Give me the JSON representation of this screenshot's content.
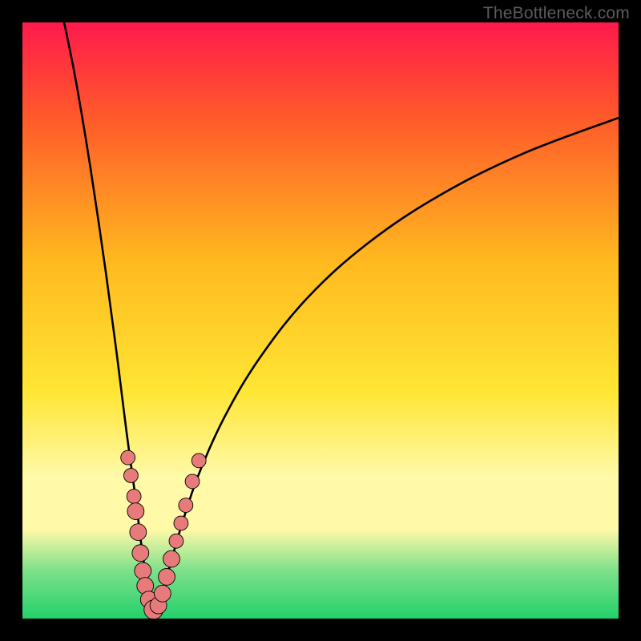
{
  "watermark": "TheBottleneck.com",
  "colors": {
    "grad_top": "#ff1a4c",
    "grad_upper": "#ff5a2a",
    "grad_mid": "#ffb91f",
    "grad_lowmid": "#ffe634",
    "grad_band": "#fff9a8",
    "grad_green1": "#7de08a",
    "grad_green2": "#24d06b",
    "curve": "#000000",
    "dot_fill": "#e77b7c",
    "dot_stroke": "#000000"
  },
  "chart_data": {
    "type": "line",
    "title": "",
    "xlabel": "",
    "ylabel": "",
    "xlim": [
      0,
      100
    ],
    "ylim": [
      0,
      100
    ],
    "x_minimum": 22,
    "gradient_stops": [
      {
        "pct": 0,
        "key": "grad_top"
      },
      {
        "pct": 16,
        "key": "grad_upper"
      },
      {
        "pct": 40,
        "key": "grad_mid"
      },
      {
        "pct": 62,
        "key": "grad_lowmid"
      },
      {
        "pct": 76,
        "key": "grad_band"
      },
      {
        "pct": 85,
        "key": "grad_band"
      },
      {
        "pct": 92,
        "key": "grad_green1"
      },
      {
        "pct": 100,
        "key": "grad_green2"
      }
    ],
    "curve_left": [
      {
        "x": 7.0,
        "y": 100.0
      },
      {
        "x": 9.0,
        "y": 90.0
      },
      {
        "x": 11.5,
        "y": 75.0
      },
      {
        "x": 14.0,
        "y": 58.0
      },
      {
        "x": 16.0,
        "y": 43.0
      },
      {
        "x": 17.5,
        "y": 31.0
      },
      {
        "x": 19.0,
        "y": 20.0
      },
      {
        "x": 20.0,
        "y": 12.0
      },
      {
        "x": 21.0,
        "y": 5.5
      },
      {
        "x": 22.0,
        "y": 1.0
      }
    ],
    "curve_right": [
      {
        "x": 22.0,
        "y": 1.0
      },
      {
        "x": 23.0,
        "y": 3.0
      },
      {
        "x": 24.5,
        "y": 8.0
      },
      {
        "x": 26.5,
        "y": 15.0
      },
      {
        "x": 29.5,
        "y": 24.0
      },
      {
        "x": 34.0,
        "y": 34.0
      },
      {
        "x": 40.0,
        "y": 44.0
      },
      {
        "x": 48.0,
        "y": 54.0
      },
      {
        "x": 58.0,
        "y": 63.0
      },
      {
        "x": 70.0,
        "y": 71.0
      },
      {
        "x": 84.0,
        "y": 78.0
      },
      {
        "x": 100.0,
        "y": 84.0
      }
    ],
    "dots": [
      {
        "x": 17.7,
        "y": 27.0,
        "r": 1.2
      },
      {
        "x": 18.2,
        "y": 24.0,
        "r": 1.2
      },
      {
        "x": 18.7,
        "y": 20.5,
        "r": 1.2
      },
      {
        "x": 19.0,
        "y": 18.0,
        "r": 1.4
      },
      {
        "x": 19.4,
        "y": 14.5,
        "r": 1.4
      },
      {
        "x": 19.8,
        "y": 11.0,
        "r": 1.4
      },
      {
        "x": 20.2,
        "y": 8.0,
        "r": 1.4
      },
      {
        "x": 20.6,
        "y": 5.5,
        "r": 1.4
      },
      {
        "x": 21.2,
        "y": 3.2,
        "r": 1.4
      },
      {
        "x": 22.0,
        "y": 1.5,
        "r": 1.6
      },
      {
        "x": 22.8,
        "y": 2.2,
        "r": 1.4
      },
      {
        "x": 23.5,
        "y": 4.2,
        "r": 1.4
      },
      {
        "x": 24.2,
        "y": 7.0,
        "r": 1.4
      },
      {
        "x": 25.0,
        "y": 10.0,
        "r": 1.4
      },
      {
        "x": 25.8,
        "y": 13.0,
        "r": 1.2
      },
      {
        "x": 26.6,
        "y": 16.0,
        "r": 1.2
      },
      {
        "x": 27.4,
        "y": 19.0,
        "r": 1.2
      },
      {
        "x": 28.5,
        "y": 23.0,
        "r": 1.2
      },
      {
        "x": 29.6,
        "y": 26.5,
        "r": 1.2
      }
    ]
  }
}
